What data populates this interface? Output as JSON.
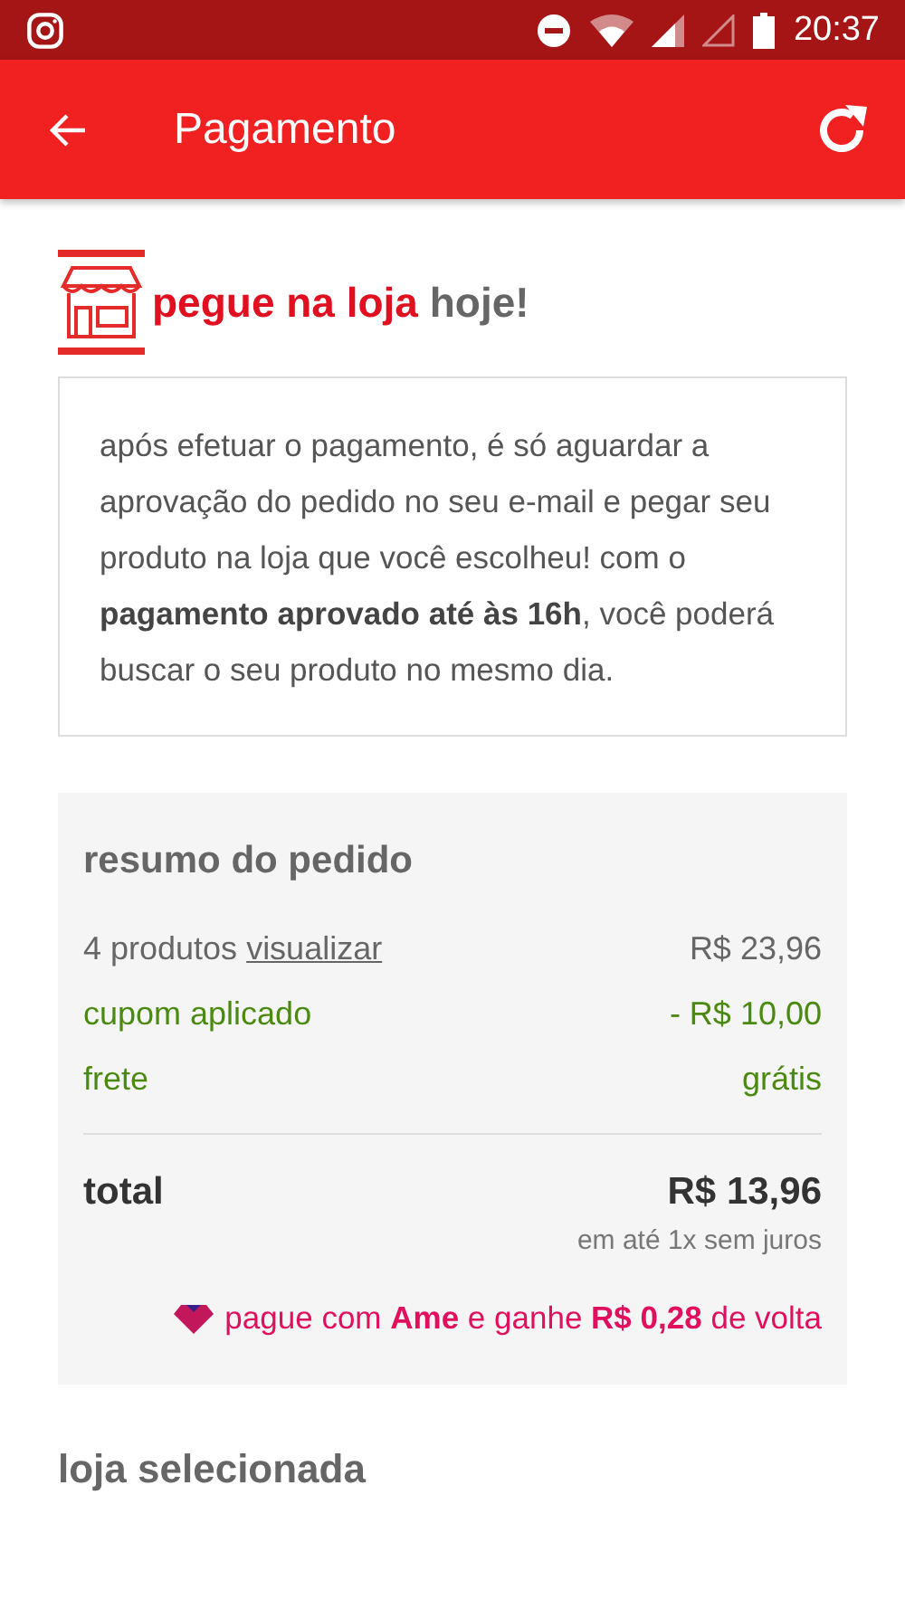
{
  "status_bar": {
    "time": "20:37"
  },
  "app_bar": {
    "title": "Pagamento"
  },
  "pickup_banner": {
    "highlight": "pegue na loja",
    "rest": "hoje!"
  },
  "notice": "após efetuar o pagamento, é só aguardar a aprovação do pedido no seu e-mail e pegar seu produto na loja que você escolheu! com o **pagamento aprovado até às 16h**, você poderá buscar o seu produto no mesmo dia.",
  "order_summary": {
    "title": "resumo do pedido",
    "rows": [
      {
        "kind": "item",
        "label": "4 produtos",
        "link": "visualizar",
        "value": "R$ 23,96"
      },
      {
        "kind": "discount",
        "label": "cupom aplicado",
        "value": "- R$ 10,00"
      },
      {
        "kind": "discount",
        "label": "frete",
        "value": "grátis"
      }
    ],
    "total_label": "total",
    "total_value": "R$ 13,96",
    "installments": "em até 1x sem juros",
    "cashback": "pague com **Ame** e ganhe **R$ 0,28** de volta"
  },
  "selected_store": {
    "title": "loja selecionada"
  }
}
